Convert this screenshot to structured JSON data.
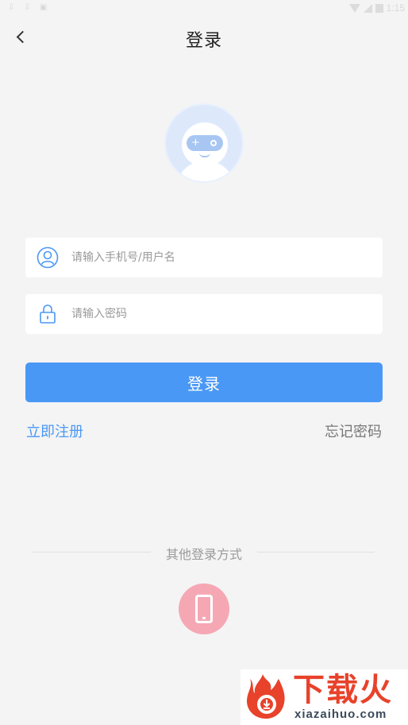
{
  "status_bar": {
    "time": "1:15",
    "left_icons": [
      "download-icon",
      "download-icon",
      "notification-icon"
    ],
    "right_icons": [
      "wifi-icon",
      "signal-icon",
      "battery-icon"
    ]
  },
  "header": {
    "title": "登录",
    "back_icon": "chevron-left-icon"
  },
  "avatar": {
    "icon": "robot-avatar-icon",
    "colors": {
      "background": "#dde9fb",
      "visor": "#a8c6f2"
    }
  },
  "form": {
    "username": {
      "placeholder": "请输入手机号/用户名",
      "value": "",
      "icon": "user-icon"
    },
    "password": {
      "placeholder": "请输入密码",
      "value": "",
      "icon": "lock-icon"
    },
    "login_label": "登录",
    "register_label": "立即注册",
    "forgot_label": "忘记密码"
  },
  "other_login": {
    "label": "其他登录方式",
    "phone_icon": "phone-icon",
    "phone_color": "#f5a8b4"
  },
  "watermark": {
    "cn": "下载火",
    "en": "xiazaihuo.com"
  },
  "colors": {
    "accent": "#4a98f5",
    "background": "#f4f4f4",
    "muted": "#777777"
  }
}
